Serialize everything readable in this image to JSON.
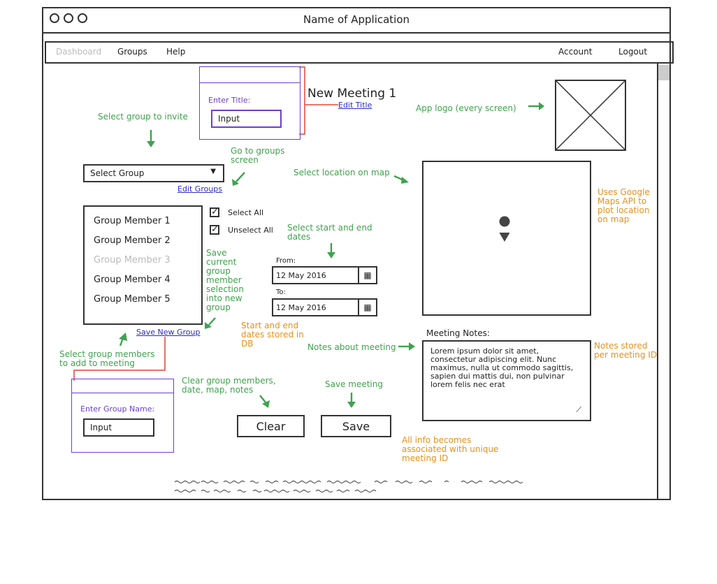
{
  "window": {
    "title": "Name of Application"
  },
  "menu": {
    "dashboard": "Dashboard",
    "groups": "Groups",
    "help": "Help",
    "account": "Account",
    "logout": "Logout"
  },
  "title_panel": {
    "label": "Enter Title:",
    "input_value": "Input",
    "heading": "New Meeting 1",
    "edit_link": "Edit Title"
  },
  "group_select": {
    "selected": "Select Group",
    "edit_link": "Edit Groups"
  },
  "members": [
    {
      "label": "Group Member 1",
      "disabled": false
    },
    {
      "label": "Group Member 2",
      "disabled": false
    },
    {
      "label": "Group Member 3",
      "disabled": true
    },
    {
      "label": "Group Member 4",
      "disabled": false
    },
    {
      "label": "Group Member 5",
      "disabled": false
    }
  ],
  "select_all": "Select All",
  "unselect_all": "Unselect All",
  "save_group_link": "Save New Group",
  "group_name_panel": {
    "label": "Enter Group Name:",
    "input_value": "Input"
  },
  "dates": {
    "from_label": "From:",
    "from_value": "12 May 2016",
    "to_label": "To:",
    "to_value": "12 May 2016"
  },
  "notes": {
    "label": "Meeting Notes:",
    "text": "Lorem ipsum dolor sit amet, consectetur adipiscing elit. Nunc maximus, nulla ut commodo sagittis, sapien dui mattis dui, non pulvinar lorem felis nec erat"
  },
  "buttons": {
    "clear": "Clear",
    "save": "Save"
  },
  "annotations": {
    "select_group_invite": "Select group to invite",
    "go_to_groups": "Go to groups screen",
    "app_logo": "App logo (every screen)",
    "select_location": "Select location on map",
    "google_maps": "Uses Google Maps API to plot location on map",
    "select_dates": "Select start and end dates",
    "save_selection": "Save current group member selection into new group",
    "dates_stored": "Start and end dates stored in DB",
    "notes_about": "Notes about meeting",
    "notes_stored": "Notes stored per meeting ID",
    "select_members": "Select group members to add to meeting",
    "clear_desc": "Clear group members, date, map, notes",
    "save_meeting": "Save meeting",
    "all_info": "All info becomes associated with unique meeting ID"
  },
  "colors": {
    "annotation_green": "#3fa34d",
    "annotation_orange": "#e9901a",
    "link_blue": "#2b2bbf",
    "panel_purple": "#6a3fd0",
    "callout_red": "#e0453a"
  }
}
